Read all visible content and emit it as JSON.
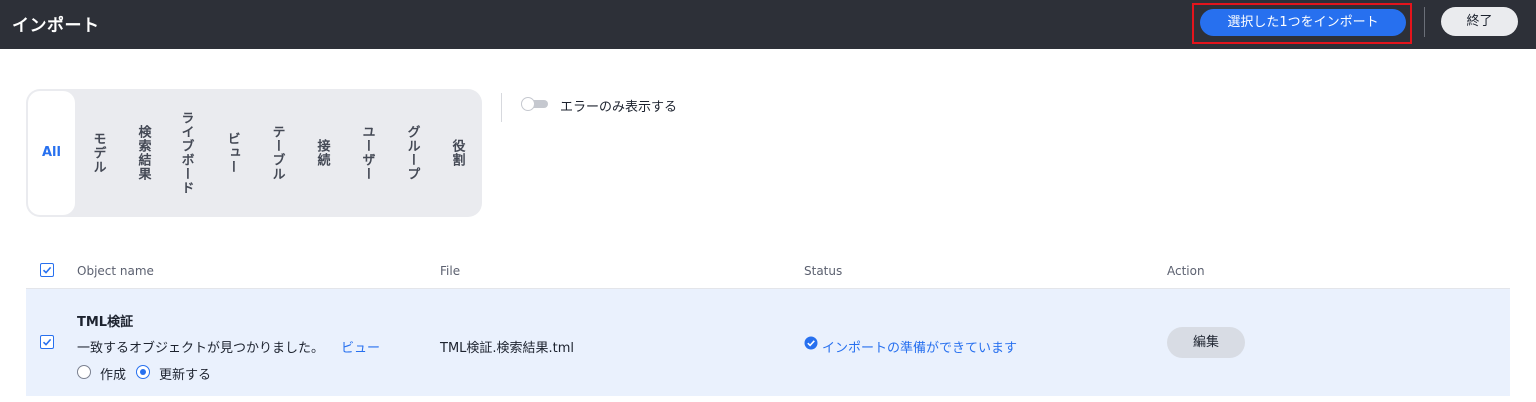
{
  "header": {
    "title": "インポート",
    "import_selected_label": "選択した1つをインポート",
    "end_label": "終了"
  },
  "filters": {
    "tabs": [
      "All",
      "モデル",
      "検索結果",
      "ライブボード",
      "ビュー",
      "テーブル",
      "接続",
      "ユーザー",
      "グループ",
      "役割"
    ],
    "active": "All"
  },
  "toggle": {
    "label": "エラーのみ表示する",
    "on": false
  },
  "table": {
    "columns": [
      "Object name",
      "File",
      "Status",
      "Action"
    ],
    "all_selected": true,
    "rows": [
      {
        "selected": true,
        "object_name": "TML検証",
        "match_text": "一致するオブジェクトが見つかりました。",
        "view_link": "ビュー",
        "options": [
          "作成",
          "更新する"
        ],
        "selected_option": "更新する",
        "file": "TML検証.検索結果.tml",
        "status": "インポートの準備ができています",
        "action": "編集"
      }
    ]
  },
  "colors": {
    "header_bg": "#2d3038",
    "accent": "#2770ef",
    "highlight": "#e3141c",
    "row_bg": "#eaf1fd"
  }
}
